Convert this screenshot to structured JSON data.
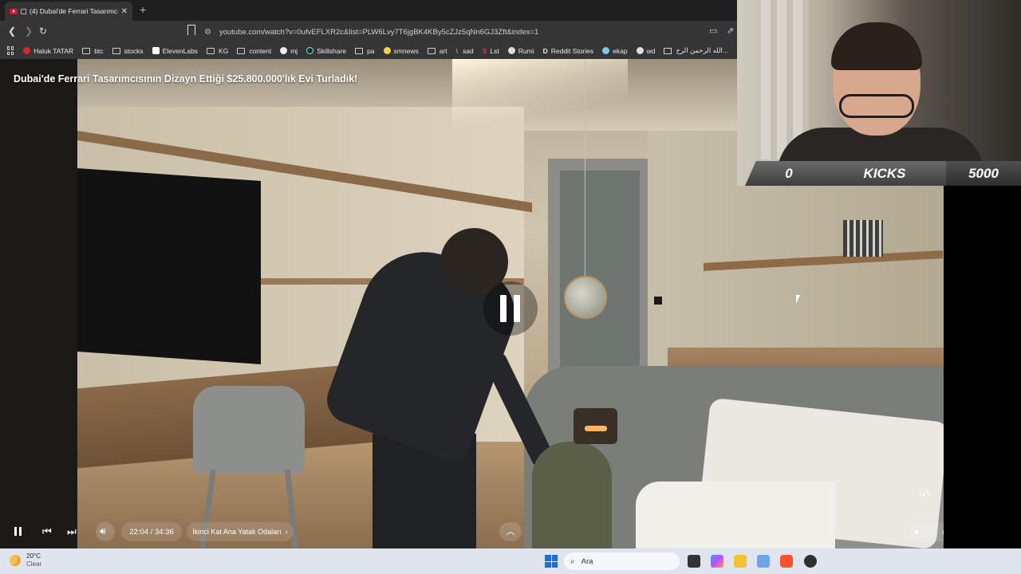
{
  "browser": {
    "tab_title": "(4) Dubai'de Ferrari Tasarımcı...",
    "url": "youtube.com/watch?v=0ufvEFLXR2c&list=PLW6Lvy7T6jgBK4KBy5cZJz5qNn6GJ3Zft&index=1",
    "bookmarks": [
      {
        "label": "Haluk TATAR",
        "icon": "youtube-icon"
      },
      {
        "label": "btc",
        "icon": "folder-icon"
      },
      {
        "label": "stocks",
        "icon": "folder-icon"
      },
      {
        "label": "ElevenLabs",
        "icon": "elevenlabs-icon"
      },
      {
        "label": "KG",
        "icon": "folder-icon"
      },
      {
        "label": "content",
        "icon": "folder-icon"
      },
      {
        "label": "mj",
        "icon": "github-icon"
      },
      {
        "label": "Skillshare",
        "icon": "skillshare-icon"
      },
      {
        "label": "pa",
        "icon": "folder-icon"
      },
      {
        "label": "smnews",
        "icon": "smiley-icon"
      },
      {
        "label": "art",
        "icon": "folder-icon"
      },
      {
        "label": "sad",
        "icon": "slash-icon"
      },
      {
        "label": "Lst",
        "icon": "s-icon"
      },
      {
        "label": "Rumi",
        "icon": "globe-icon"
      },
      {
        "label": "Reddit Stories",
        "icon": "d-icon"
      },
      {
        "label": "ekap",
        "icon": "bird-icon"
      },
      {
        "label": "wd",
        "icon": "globe-icon"
      },
      {
        "label": "الله الرحمن الرح...",
        "icon": "doc-icon"
      }
    ]
  },
  "video": {
    "title": "Dubai'de Ferrari Tasarımcısının Dizayn Ettiği $25.800.000'lık Evi Turladık!",
    "time": "22:04 / 34:36",
    "chapter": "İkinci Kat Ana Yatak Odaları",
    "progress_fraction": 0.6378,
    "chapter_marks": [
      0.06,
      0.105,
      0.32,
      0.445,
      0.57,
      0.645,
      0.85
    ],
    "colors": {
      "progress": "#ff0033"
    }
  },
  "overlay": {
    "left_count": "0",
    "label": "KICKS",
    "right_count": "5000"
  },
  "taskbar": {
    "temperature": "20°C",
    "condition": "Clear",
    "search_placeholder": "Ara"
  }
}
